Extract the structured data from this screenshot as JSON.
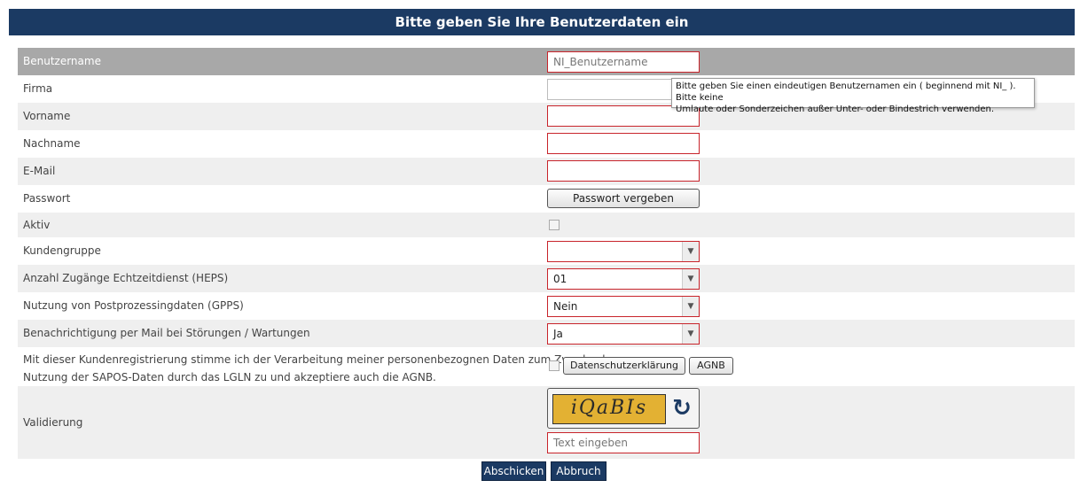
{
  "header": {
    "title": "Bitte geben Sie Ihre Benutzerdaten ein"
  },
  "fields": {
    "benutzername": {
      "label": "Benutzername",
      "placeholder": "NI_Benutzername"
    },
    "firma": {
      "label": "Firma",
      "value": ""
    },
    "vorname": {
      "label": "Vorname",
      "value": ""
    },
    "nachname": {
      "label": "Nachname",
      "value": ""
    },
    "email": {
      "label": "E-Mail",
      "value": ""
    },
    "passwort": {
      "label": "Passwort",
      "button": "Passwort vergeben"
    },
    "aktiv": {
      "label": "Aktiv"
    },
    "kundengruppe": {
      "label": "Kundengruppe",
      "value": ""
    },
    "heps": {
      "label": "Anzahl Zugänge Echtzeitdienst (HEPS)",
      "value": "01"
    },
    "gpps": {
      "label": "Nutzung von Postprozessingdaten (GPPS)",
      "value": "Nein"
    },
    "benachrichtigung": {
      "label": "Benachrichtigung per Mail bei Störungen / Wartungen",
      "value": "Ja"
    },
    "datenschutz": {
      "label_line1": "Mit dieser Kundenregistrierung stimme ich der Verarbeitung meiner personenbezognen Daten zum Zwecke der",
      "label_line2": "Nutzung der SAPOS-Daten durch das LGLN zu und akzeptiere auch die AGNB.",
      "btn_datenschutz": "Datenschutzerklärung",
      "btn_agnb": "AGNB"
    },
    "validierung": {
      "label": "Validierung",
      "captcha_text": "iQaBIs",
      "placeholder": "Text eingeben"
    }
  },
  "tooltip": {
    "line1": "Bitte geben Sie einen eindeutigen Benutzernamen ein ( beginnend mit NI_ ). Bitte keine",
    "line2": "Umlaute oder Sonderzeichen außer Unter- oder Bindestrich verwenden."
  },
  "actions": {
    "submit": "Abschicken",
    "cancel": "Abbruch"
  },
  "colors": {
    "header_bg": "#1b3a63",
    "required_border": "#c8242b",
    "row_alt": "#efefef",
    "head_row": "#a8a8a8"
  },
  "icons": {
    "dropdown": "chevron-down-icon",
    "refresh": "refresh-icon"
  }
}
